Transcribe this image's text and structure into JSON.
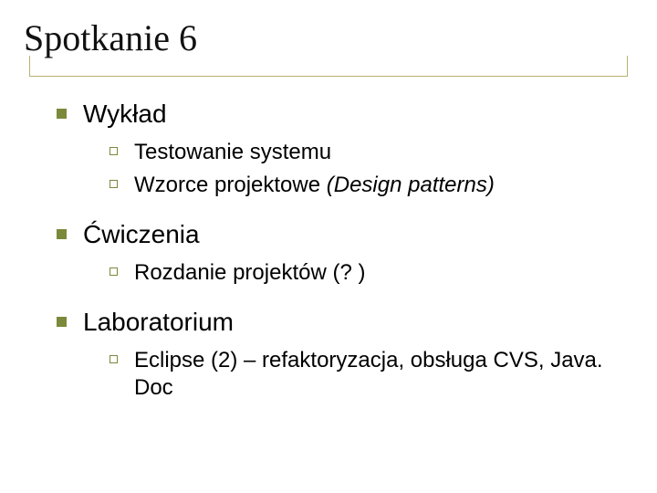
{
  "title": "Spotkanie 6",
  "sections": [
    {
      "heading": "Wykład",
      "items": [
        {
          "text": "Testowanie systemu"
        },
        {
          "text": "Wzorce projektowe ",
          "italic_suffix": "(Design patterns)"
        }
      ]
    },
    {
      "heading": "Ćwiczenia",
      "items": [
        {
          "text": "Rozdanie projektów (? )"
        }
      ]
    },
    {
      "heading": "Laboratorium",
      "items": [
        {
          "text": "Eclipse (2) – refaktoryzacja, obsługa CVS, Java. Doc"
        }
      ]
    }
  ]
}
